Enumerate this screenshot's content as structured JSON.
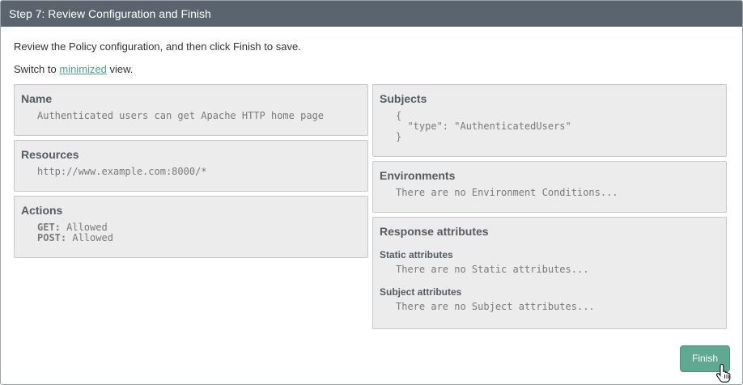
{
  "header": {
    "title": "Step 7: Review Configuration and Finish"
  },
  "intro": "Review the Policy configuration, and then click Finish to save.",
  "switch_view": {
    "prefix": "Switch to ",
    "link": "minimized",
    "suffix": " view."
  },
  "name_box": {
    "title": "Name",
    "value": "Authenticated users can get Apache HTTP home page"
  },
  "resources_box": {
    "title": "Resources",
    "value": "http://www.example.com:8000/*"
  },
  "actions_box": {
    "title": "Actions",
    "items": [
      {
        "key": "GET:",
        "value": " Allowed"
      },
      {
        "key": "POST:",
        "value": " Allowed"
      }
    ]
  },
  "subjects_box": {
    "title": "Subjects",
    "line1": "{",
    "line2": "  \"type\": \"AuthenticatedUsers\"",
    "line3": "}"
  },
  "environments_box": {
    "title": "Environments",
    "value": "There are no Environment Conditions..."
  },
  "response_box": {
    "title": "Response attributes",
    "static_title": "Static attributes",
    "static_value": "There are no Static attributes...",
    "subject_title": "Subject attributes",
    "subject_value": "There are no Subject attributes..."
  },
  "finish_button": {
    "label": "Finish"
  },
  "colors": {
    "header_bg": "#5a646e",
    "accent": "#5fa892",
    "link": "#4fa38a",
    "box_bg": "#ececec"
  },
  "icons": {
    "cursor": "hand-pointer-icon"
  }
}
